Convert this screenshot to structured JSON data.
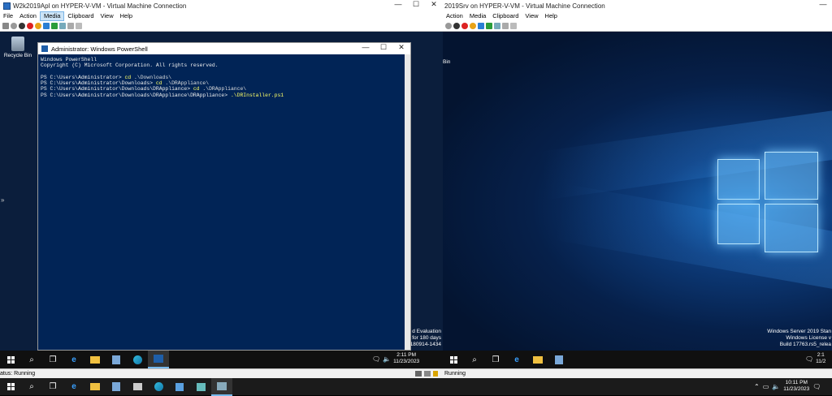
{
  "left_vm": {
    "title": "W2k2019Apl on HYPER-V-VM - Virtual Machine Connection",
    "menu": [
      "File",
      "Action",
      "Media",
      "Clipboard",
      "View",
      "Help"
    ],
    "active_menu": "Media",
    "recycle_bin": "Recycle Bin",
    "status": "atus: Running",
    "eval_lines": [
      "d Evaluation",
      "for 180 days",
      "180914-1434"
    ],
    "clock_time": "2:11 PM",
    "clock_date": "11/23/2023"
  },
  "right_vm": {
    "title": "2019Srv on HYPER-V-VM - Virtual Machine Connection",
    "menu": [
      "Action",
      "Media",
      "Clipboard",
      "View",
      "Help"
    ],
    "recycle_bin": "Bin",
    "status": "Running",
    "watermark": [
      "Windows Server 2019 Stan",
      "Windows License v",
      "Build 17763.rs5_relea"
    ],
    "clock_time": "2:1",
    "clock_date": "11/2"
  },
  "powershell": {
    "title": "Administrator: Windows PowerShell",
    "header1": "Windows PowerShell",
    "header2": "Copyright (C) Microsoft Corporation. All rights reserved.",
    "lines": [
      {
        "prompt": "PS C:\\Users\\Administrator> ",
        "cmd": "cd",
        "arg": " .\\Downloads\\"
      },
      {
        "prompt": "PS C:\\Users\\Administrator\\Downloads> ",
        "cmd": "cd",
        "arg": " .\\DRAppliance\\"
      },
      {
        "prompt": "PS C:\\Users\\Administrator\\Downloads\\DRAppliance> ",
        "cmd": "cd",
        "arg": " .\\DRAppliance\\"
      },
      {
        "prompt": "PS C:\\Users\\Administrator\\Downloads\\DRAppliance\\DRAppliance> ",
        "cmd": ".\\DRInstaller.ps1",
        "arg": ""
      }
    ]
  },
  "host": {
    "clock_time": "10:11 PM",
    "clock_date": "11/23/2023"
  }
}
